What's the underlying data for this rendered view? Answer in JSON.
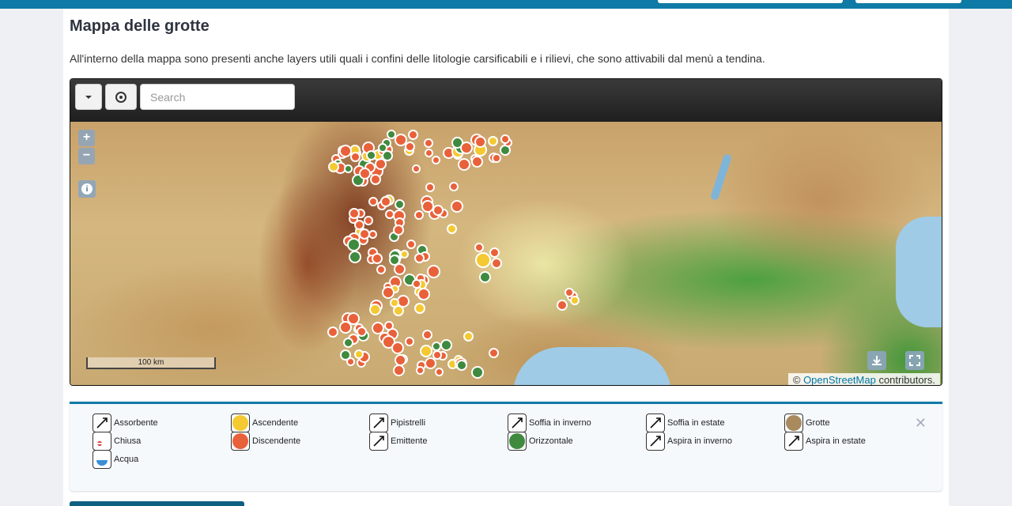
{
  "page": {
    "title": "Mappa delle grotte",
    "description": "All'interno della mappa sono presenti anche layers utili quali i confini delle litologie carsificabili e i rilievi, che sono attivabili dal menù a tendina."
  },
  "toolbar": {
    "search_placeholder": "Search"
  },
  "map": {
    "zoom_in": "+",
    "zoom_out": "−",
    "scale_label": "100 km",
    "coords": "(coordinate readout)",
    "attribution_prefix": "© ",
    "attribution_link": "OpenStreetMap",
    "attribution_suffix": " contributors."
  },
  "colors": {
    "accent": "#0f7aa6",
    "marker_orange": "#e8613a",
    "marker_yellow": "#f4c932",
    "marker_green": "#3f8a3f",
    "marker_brown": "#a88a5e"
  },
  "legend": {
    "items": [
      {
        "label": "Assorbente",
        "icon": "assorbente-icon"
      },
      {
        "label": "Ascendente",
        "icon": "yellow-dot-icon"
      },
      {
        "label": "Pipistrelli",
        "icon": "bat-icon"
      },
      {
        "label": "Soffia in inverno",
        "icon": "winter-blow-icon"
      },
      {
        "label": "Soffia in estate",
        "icon": "summer-blow-icon"
      },
      {
        "label": "Grotte",
        "icon": "brown-dot-icon"
      },
      {
        "label": "Chiusa",
        "icon": "closed-icon"
      },
      {
        "label": "Discendente",
        "icon": "orange-dot-icon"
      },
      {
        "label": "Emittente",
        "icon": "emitter-icon"
      },
      {
        "label": "Orizzontale",
        "icon": "green-dot-icon"
      },
      {
        "label": "Aspira in inverno",
        "icon": "winter-suck-icon"
      },
      {
        "label": "Aspira in estate",
        "icon": "summer-suck-icon"
      },
      {
        "label": "Acqua",
        "icon": "water-icon"
      }
    ],
    "close": "✕"
  }
}
